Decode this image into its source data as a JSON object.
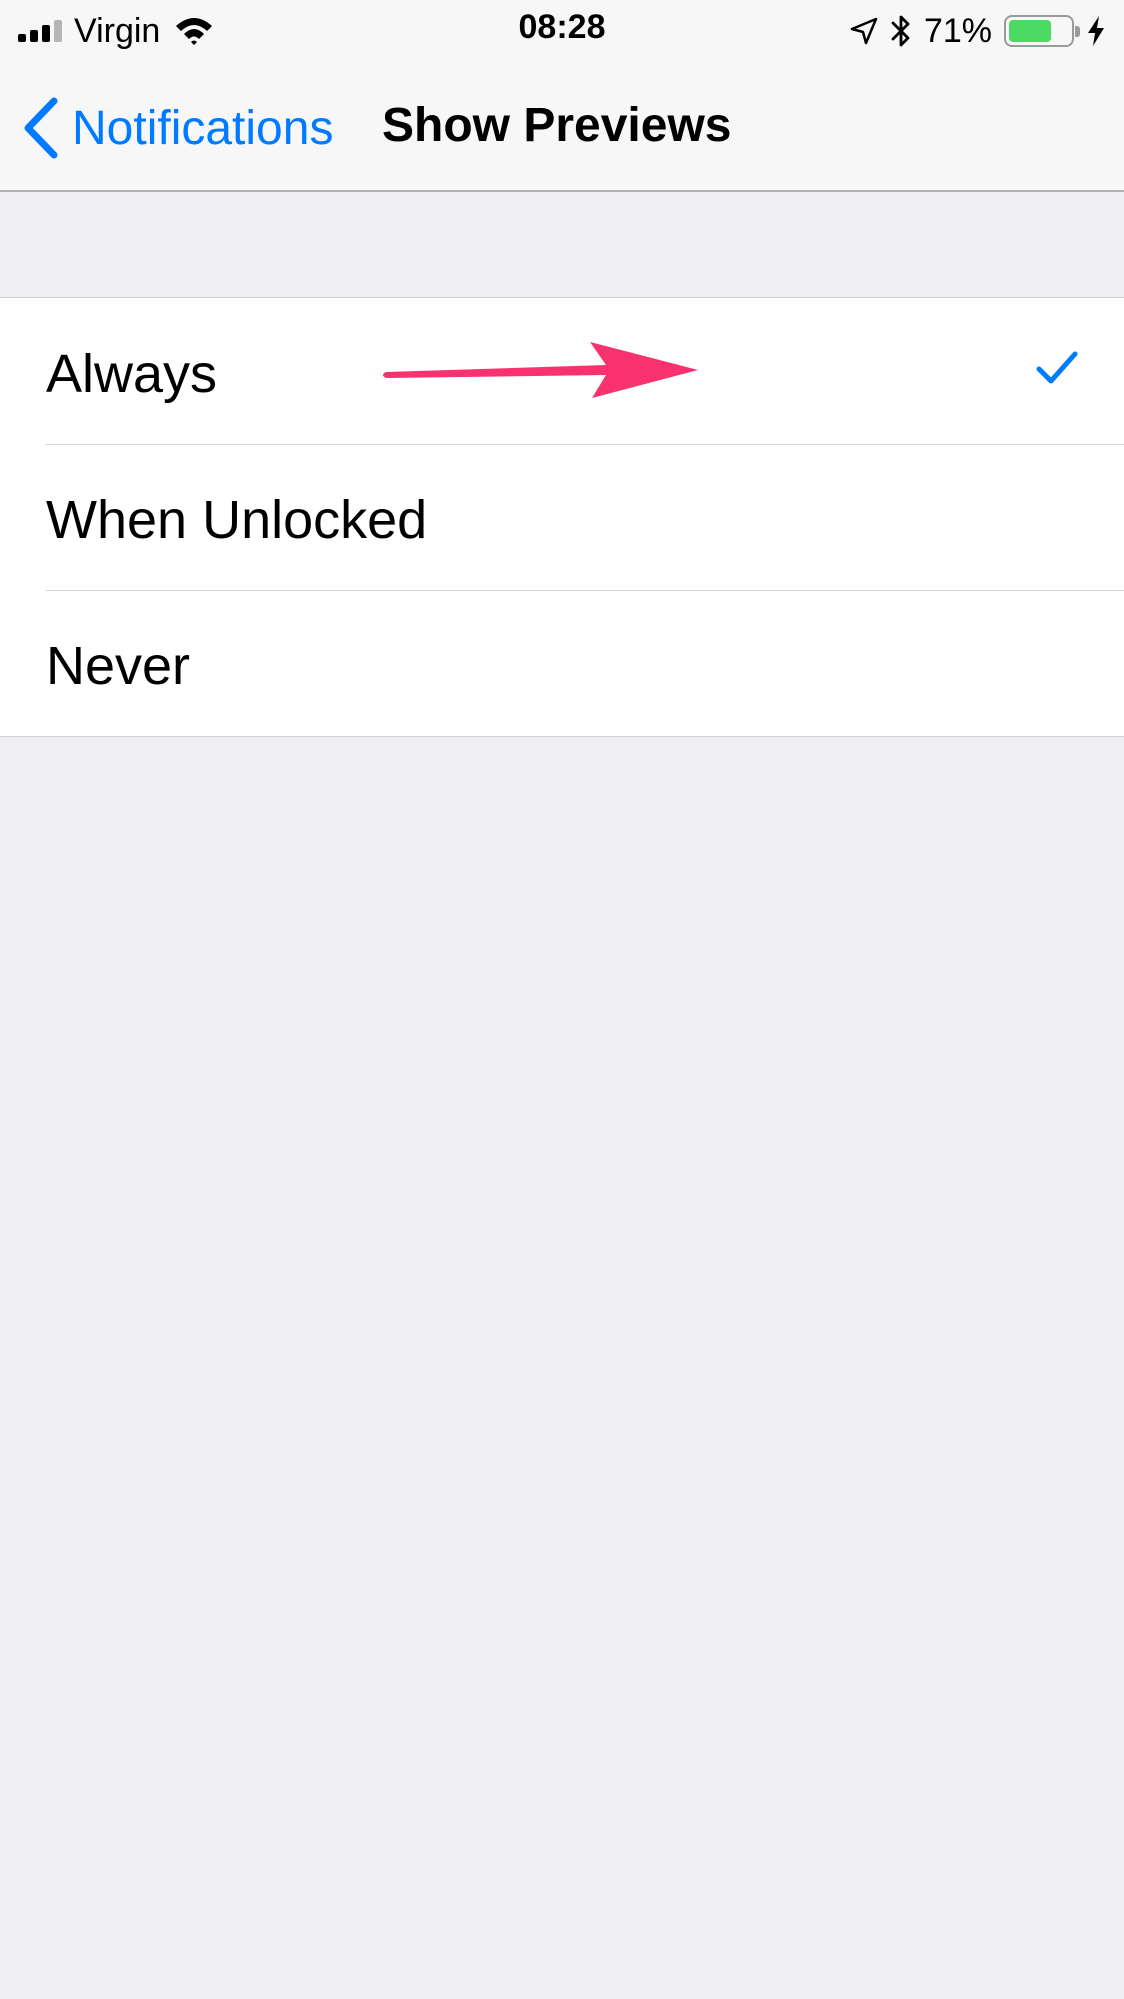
{
  "status_bar": {
    "carrier": "Virgin",
    "time": "08:28",
    "battery_percent_label": "71%",
    "battery_level": 0.71,
    "signal_bars_active": 3,
    "signal_bars_total": 4,
    "icons": [
      "signal-icon",
      "wifi-icon",
      "location-icon",
      "bluetooth-icon",
      "battery-icon",
      "charging-icon"
    ]
  },
  "nav": {
    "back_label": "Notifications",
    "title": "Show Previews"
  },
  "options": [
    {
      "label": "Always",
      "selected": true
    },
    {
      "label": "When Unlocked",
      "selected": false
    },
    {
      "label": "Never",
      "selected": false
    }
  ],
  "colors": {
    "accent": "#007aff",
    "annotation_arrow": "#f7326e",
    "battery_fill": "#4cd964",
    "background": "#efeff4"
  }
}
